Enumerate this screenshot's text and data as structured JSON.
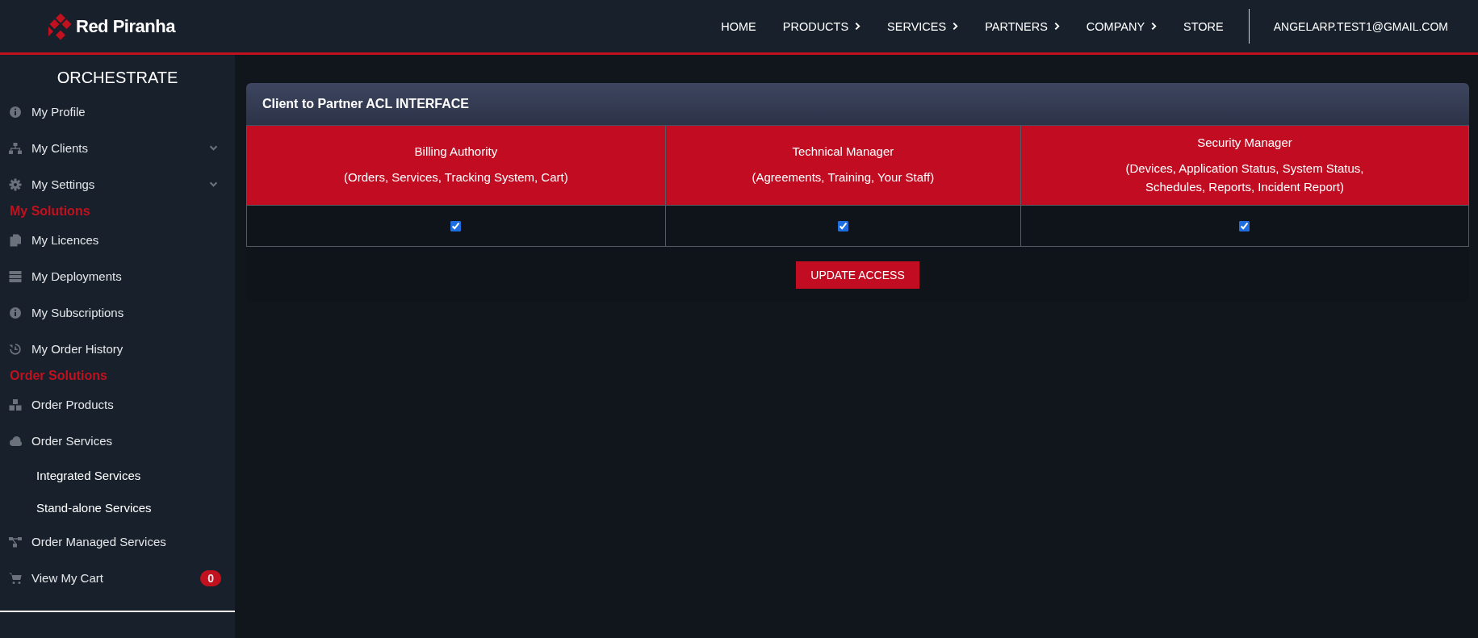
{
  "header": {
    "brand": "Red Piranha",
    "nav": [
      {
        "label": "HOME",
        "submenu": false
      },
      {
        "label": "PRODUCTS",
        "submenu": true
      },
      {
        "label": "SERVICES",
        "submenu": true
      },
      {
        "label": "PARTNERS",
        "submenu": true
      },
      {
        "label": "COMPANY",
        "submenu": true
      },
      {
        "label": "STORE",
        "submenu": false
      }
    ],
    "user": "ANGELARP.TEST1@GMAIL.COM"
  },
  "sidebar": {
    "title": "ORCHESTRATE",
    "items": [
      {
        "kind": "link",
        "label": "My Profile",
        "dropdown": false
      },
      {
        "kind": "link",
        "label": "My Clients",
        "dropdown": true
      },
      {
        "kind": "link",
        "label": "My Settings",
        "dropdown": true
      },
      {
        "kind": "heading",
        "label": "My Solutions"
      },
      {
        "kind": "link",
        "label": "My Licences",
        "dropdown": false
      },
      {
        "kind": "link",
        "label": "My Deployments",
        "dropdown": false
      },
      {
        "kind": "link",
        "label": "My Subscriptions",
        "dropdown": false
      },
      {
        "kind": "link",
        "label": "My Order History",
        "dropdown": false
      },
      {
        "kind": "heading",
        "label": "Order Solutions"
      },
      {
        "kind": "link",
        "label": "Order Products",
        "dropdown": false
      },
      {
        "kind": "link",
        "label": "Order Services",
        "dropdown": false,
        "children": [
          {
            "label": "Integrated Services"
          },
          {
            "label": "Stand-alone Services"
          }
        ]
      },
      {
        "kind": "link",
        "label": "Order Managed Services",
        "dropdown": false
      },
      {
        "kind": "link",
        "label": "View My Cart",
        "dropdown": false,
        "badge": "0"
      }
    ]
  },
  "panel": {
    "title": "Client to Partner ACL INTERFACE",
    "columns": [
      {
        "name": "Billing Authority",
        "scope": "(Orders, Services, Tracking System, Cart)",
        "checked": true
      },
      {
        "name": "Technical Manager",
        "scope": "(Agreements, Training, Your Staff)",
        "checked": true
      },
      {
        "name": "Security Manager",
        "scope": "(Devices, Application Status, System Status, Schedules, Reports, Incident Report)",
        "checked": true
      }
    ],
    "button": "UPDATE ACCESS"
  }
}
